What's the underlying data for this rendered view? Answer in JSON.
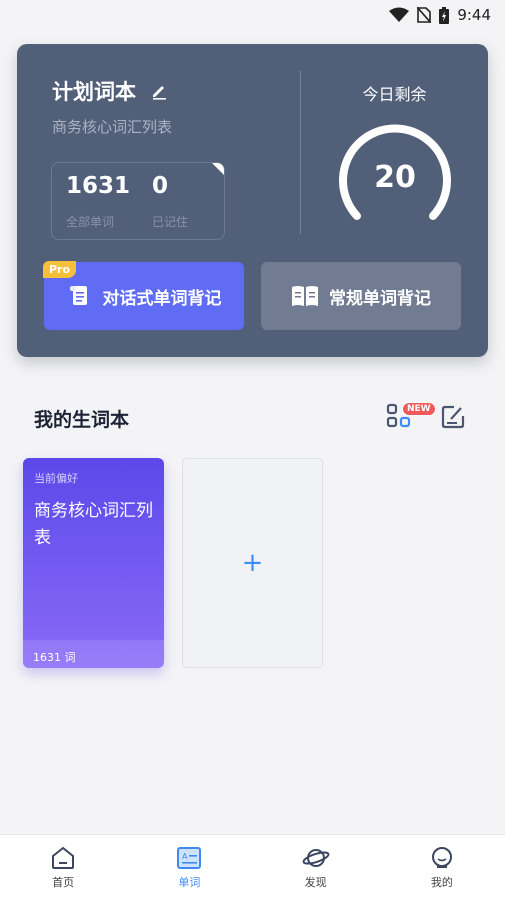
{
  "status": {
    "time": "9:44"
  },
  "plan": {
    "title": "计划词本",
    "subtitle": "商务核心词汇列表",
    "total_words": "1631",
    "total_label": "全部单词",
    "memorized": "0",
    "memorized_label": "已记住",
    "remaining_label": "今日剩余",
    "remaining": "20",
    "dialog_button": "对话式单词背记",
    "pro_badge": "Pro",
    "normal_button": "常规单词背记"
  },
  "vocab": {
    "title": "我的生词本",
    "new_badge": "NEW",
    "card": {
      "pref_label": "当前偏好",
      "name": "商务核心词汇列表",
      "count": "1631 词"
    },
    "add_symbol": "+"
  },
  "nav": {
    "items": [
      {
        "label": "首页",
        "icon": "home-icon"
      },
      {
        "label": "单词",
        "icon": "word-icon"
      },
      {
        "label": "发现",
        "icon": "planet-icon"
      },
      {
        "label": "我的",
        "icon": "profile-icon"
      }
    ],
    "active_index": 1,
    "active_color": "#3f8af2"
  }
}
